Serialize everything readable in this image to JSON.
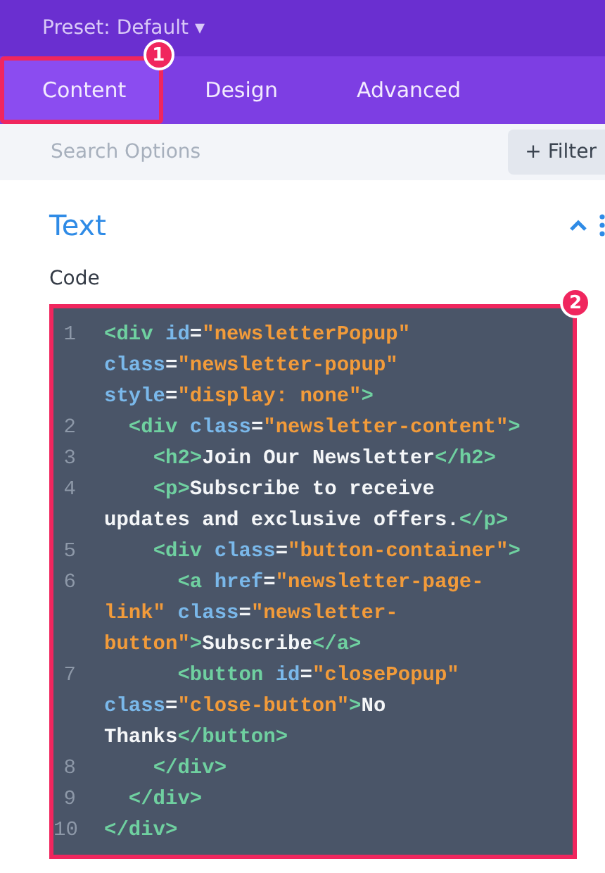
{
  "header": {
    "preset": "Preset: Default",
    "caret": "▾"
  },
  "tabs": [
    {
      "label": "Content",
      "selected": true,
      "callout": "1"
    },
    {
      "label": "Design",
      "selected": false
    },
    {
      "label": "Advanced",
      "selected": false
    }
  ],
  "search": {
    "placeholder": "Search Options",
    "filter_button": "+ Filter"
  },
  "section": {
    "title": "Text",
    "expanded": true,
    "field_label": "Code",
    "callout": "2",
    "code_lines": [
      {
        "number": "1",
        "tokens": [
          {
            "kind": "tag",
            "text": "<div "
          },
          {
            "kind": "attr",
            "text": "id"
          },
          {
            "kind": "plain",
            "text": "="
          },
          {
            "kind": "str",
            "text": "\"newsletterPopup\""
          },
          {
            "kind": "attr",
            "text": " class"
          },
          {
            "kind": "plain",
            "text": "="
          },
          {
            "kind": "str",
            "text": "\"newsletter-popup\""
          },
          {
            "kind": "attr",
            "text": " style"
          },
          {
            "kind": "plain",
            "text": "="
          },
          {
            "kind": "str",
            "text": "\"display: none\""
          },
          {
            "kind": "tag",
            "text": ">"
          }
        ]
      },
      {
        "number": "2",
        "tokens": [
          {
            "kind": "tag",
            "text": "  <div "
          },
          {
            "kind": "attr",
            "text": "class"
          },
          {
            "kind": "plain",
            "text": "="
          },
          {
            "kind": "str",
            "text": "\"newsletter-content\""
          },
          {
            "kind": "tag",
            "text": ">"
          }
        ]
      },
      {
        "number": "3",
        "tokens": [
          {
            "kind": "tag",
            "text": "    <h2>"
          },
          {
            "kind": "plain",
            "text": "Join Our Newsletter"
          },
          {
            "kind": "tag",
            "text": "</h2>"
          }
        ]
      },
      {
        "number": "4",
        "tokens": [
          {
            "kind": "tag",
            "text": "    <p>"
          },
          {
            "kind": "plain",
            "text": "Subscribe to receive updates and exclusive offers."
          },
          {
            "kind": "tag",
            "text": "</p>"
          }
        ]
      },
      {
        "number": "5",
        "tokens": [
          {
            "kind": "tag",
            "text": "    <div "
          },
          {
            "kind": "attr",
            "text": "class"
          },
          {
            "kind": "plain",
            "text": "="
          },
          {
            "kind": "str",
            "text": "\"button-container\""
          },
          {
            "kind": "tag",
            "text": ">"
          }
        ]
      },
      {
        "number": "6",
        "tokens": [
          {
            "kind": "tag",
            "text": "      <a "
          },
          {
            "kind": "attr",
            "text": "href"
          },
          {
            "kind": "plain",
            "text": "="
          },
          {
            "kind": "str",
            "text": "\"newsletter-page-link\""
          },
          {
            "kind": "attr",
            "text": " class"
          },
          {
            "kind": "plain",
            "text": "="
          },
          {
            "kind": "str",
            "text": "\"newsletter-button\""
          },
          {
            "kind": "tag",
            "text": ">"
          },
          {
            "kind": "plain",
            "text": "Subscribe"
          },
          {
            "kind": "tag",
            "text": "</a>"
          }
        ]
      },
      {
        "number": "7",
        "tokens": [
          {
            "kind": "tag",
            "text": "      <button "
          },
          {
            "kind": "attr",
            "text": "id"
          },
          {
            "kind": "plain",
            "text": "="
          },
          {
            "kind": "str",
            "text": "\"closePopup\""
          },
          {
            "kind": "attr",
            "text": " class"
          },
          {
            "kind": "plain",
            "text": "="
          },
          {
            "kind": "str",
            "text": "\"close-button\""
          },
          {
            "kind": "tag",
            "text": ">"
          },
          {
            "kind": "plain",
            "text": "No Thanks"
          },
          {
            "kind": "tag",
            "text": "</button>"
          }
        ]
      },
      {
        "number": "8",
        "tokens": [
          {
            "kind": "tag",
            "text": "    </div>"
          }
        ]
      },
      {
        "number": "9",
        "tokens": [
          {
            "kind": "tag",
            "text": "  </div>"
          }
        ]
      },
      {
        "number": "10",
        "tokens": [
          {
            "kind": "tag",
            "text": "</div>"
          }
        ]
      }
    ]
  }
}
